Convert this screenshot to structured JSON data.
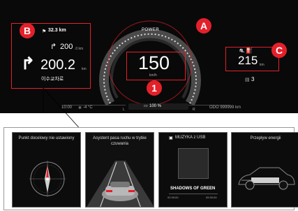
{
  "markers": {
    "a": "A",
    "b": "B",
    "c": "C",
    "one": "1"
  },
  "navigation": {
    "distance": "32.3 km",
    "next_turn_value": "200",
    "next_turn_unit": ".0 km",
    "main_turn_value": "200.2",
    "main_turn_unit": "km",
    "street_name": "이수교차로"
  },
  "gauge": {
    "label": "POWER",
    "speed": "150",
    "speed_unit": "km/h"
  },
  "range": {
    "value": "215",
    "unit": "km",
    "gear": "3"
  },
  "status": {
    "time": "10:00",
    "temperature": "-4 °C",
    "left_label": "L",
    "battery": "100 %",
    "right_label": "R",
    "odometer": "ODO 999999 km"
  },
  "panels": [
    {
      "title": "Punkt docelowy nie ustawiony"
    },
    {
      "title": "Asystent pasa ruchu w trybie czuwania"
    },
    {
      "title": "MUZYKA z USB",
      "track": "SHADOWS OF GREEN",
      "time_elapsed": "02:39:00",
      "time_total": "05:30:00"
    },
    {
      "title": "Przepływ energii"
    }
  ],
  "colors": {
    "accent": "#e4202a",
    "background": "#090909",
    "gauge_ring": "#8a8a8a"
  }
}
